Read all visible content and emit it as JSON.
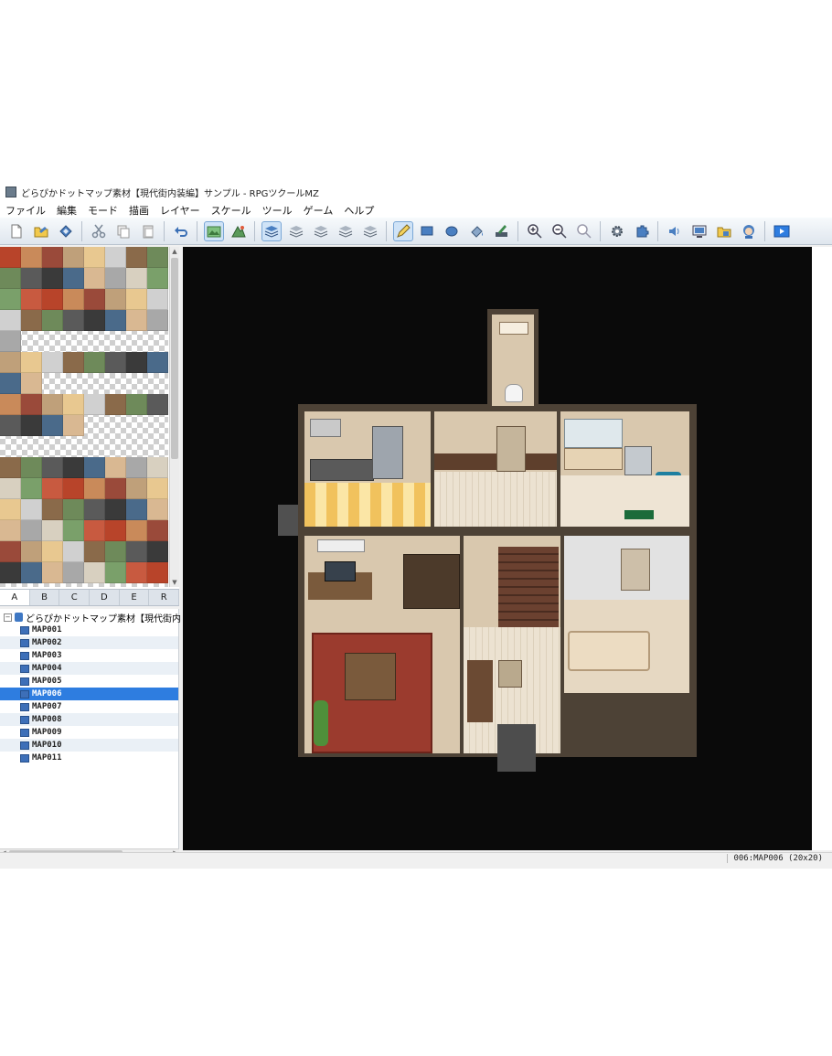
{
  "window": {
    "title": "どらぴかドットマップ素材【現代街内装編】サンプル - RPGツクールMZ"
  },
  "menu": [
    "ファイル",
    "編集",
    "モード",
    "描画",
    "レイヤー",
    "スケール",
    "ツール",
    "ゲーム",
    "ヘルプ"
  ],
  "toolbar": {
    "icons": [
      "new-project-icon",
      "open-project-icon",
      "save-project-icon",
      "cut-icon",
      "copy-icon",
      "paste-icon",
      "undo-icon",
      "map-mode-icon",
      "event-mode-icon",
      "layer-auto-icon",
      "layer-1-icon",
      "layer-2-icon",
      "layer-3-icon",
      "layer-4-icon",
      "pencil-icon",
      "rectangle-icon",
      "ellipse-icon",
      "fill-icon",
      "shadow-pen-icon",
      "zoom-in-icon",
      "zoom-out-icon",
      "zoom-actual-icon",
      "database-icon",
      "plugin-manager-icon",
      "sound-test-icon",
      "event-searcher-icon",
      "resource-manager-icon",
      "character-generator-icon",
      "playtest-icon"
    ],
    "active": [
      "map-mode-icon",
      "layer-auto-icon",
      "pencil-icon"
    ]
  },
  "tileset": {
    "tabs": [
      "A",
      "B",
      "C",
      "D",
      "E",
      "R"
    ],
    "selected_tab": "A"
  },
  "map_tree": {
    "root": "どらぴかドットマップ素材【現代街内",
    "items": [
      "MAP001",
      "MAP002",
      "MAP003",
      "MAP004",
      "MAP005",
      "MAP006",
      "MAP007",
      "MAP008",
      "MAP009",
      "MAP010",
      "MAP011"
    ],
    "selected": "MAP006"
  },
  "status": {
    "map_info": "006:MAP006 (20x20)"
  },
  "colors": {
    "selection": "#2e7de0",
    "map_background": "#0a0a0a",
    "floor_wood": "#e7dccb",
    "wall_beige": "#d9c8ae",
    "rug_red": "#9b3b2e"
  }
}
